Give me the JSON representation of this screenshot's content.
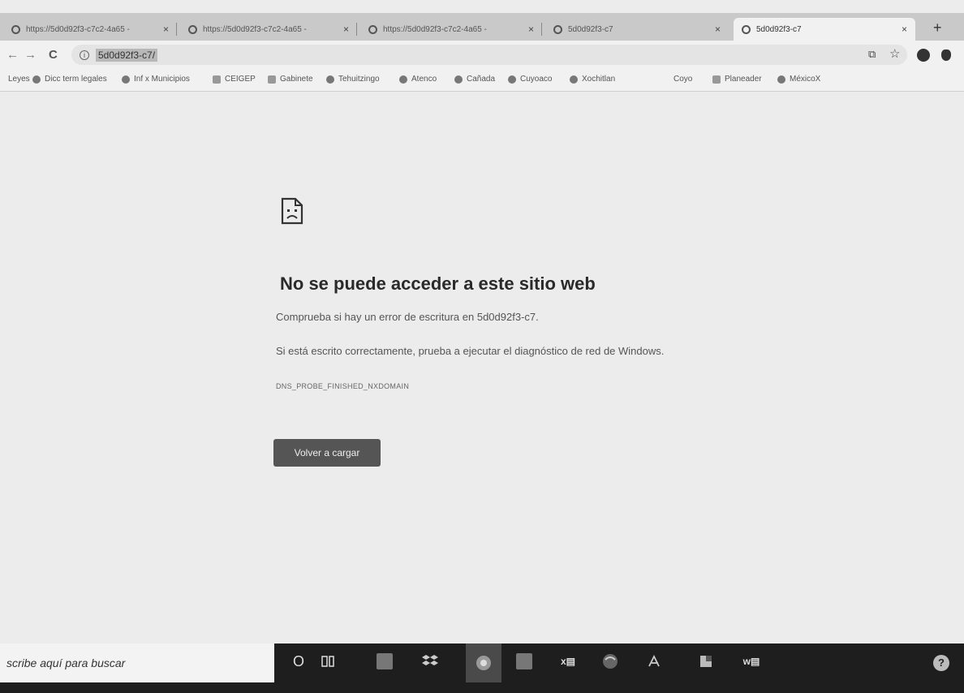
{
  "tabs": [
    {
      "title": "https://5d0d92f3-c7c2-4a65 -",
      "close": "×"
    },
    {
      "title": "https://5d0d92f3-c7c2-4a65 -",
      "close": "×"
    },
    {
      "title": "https://5d0d92f3-c7c2-4a65 -",
      "close": "×"
    },
    {
      "title": "5d0d92f3-c7",
      "close": "×"
    },
    {
      "title": "5d0d92f3-c7",
      "close": "×"
    }
  ],
  "new_tab_label": "+",
  "toolbar": {
    "back": "←",
    "forward": "→",
    "reload": "C",
    "info_glyph": "i",
    "url": "5d0d92f3-c7/",
    "cast_glyph": "⧉",
    "star_glyph": "☆"
  },
  "bookmarks": [
    "Leyes",
    "Dicc term legales",
    "Inf x Municipios",
    "CEIGEP",
    "Gabinete",
    "Tehuitzingo",
    "Atenco",
    "Cañada",
    "Cuyoaco",
    "Xochitlan",
    "Coyo",
    "Planeader",
    "MéxicoX"
  ],
  "error": {
    "title": "No se puede acceder a este sitio web",
    "line1": "Comprueba si hay un error de escritura en 5d0d92f3-c7.",
    "line2": "Si está escrito correctamente, prueba a ejecutar el diagnóstico de red de Windows.",
    "code": "DNS_PROBE_FINISHED_NXDOMAIN",
    "reload_button": "Volver a cargar"
  },
  "taskbar": {
    "search_placeholder": "scribe aquí para buscar",
    "cortana_glyph": "O",
    "help_glyph": "?"
  }
}
